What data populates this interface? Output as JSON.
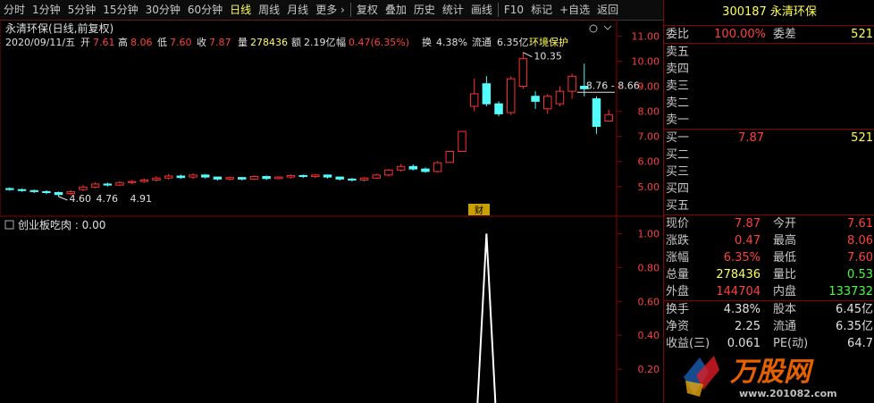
{
  "toolbar": {
    "items": [
      "分时",
      "1分钟",
      "5分钟",
      "15分钟",
      "30分钟",
      "60分钟",
      "日线",
      "周线",
      "月线",
      "更多 ›",
      "复权",
      "叠加",
      "历史",
      "统计",
      "画线",
      "F10",
      "标记",
      "+自选",
      "返回"
    ],
    "active_index": 6
  },
  "main": {
    "title": "永清环保(日线,前复权)",
    "info": {
      "date": "2020/09/11/五",
      "open_label": "开",
      "open": "7.61",
      "high_label": "高",
      "high": "8.06",
      "low_label": "低",
      "low": "7.60",
      "close_label": "收",
      "close": "7.87",
      "volume_label": "量",
      "volume": "278436",
      "amount_label": "额",
      "amount": "2.19亿",
      "change_label": "幅",
      "change": "0.47(6.35%)",
      "turnover_label": "换",
      "turnover": "4.38%",
      "float_label": "流通",
      "float": "6.35亿",
      "concept": "环境保护"
    },
    "y_ticks": [
      "11.00",
      "10.00",
      "9.00",
      "8.00",
      "7.00",
      "6.00",
      "5.00"
    ],
    "annotations": {
      "high_marker": "10.35",
      "low_marker": "4.60",
      "low_marker_b": "4.76",
      "low_marker_c": "4.91",
      "range_label": "8.76 - 8.66"
    },
    "finance_tag": "财"
  },
  "indicator": {
    "title": "创业板吃肉 : 0.00",
    "y_ticks": [
      "1.00",
      "0.80",
      "0.60",
      "0.40",
      "0.20"
    ]
  },
  "chart_data": {
    "type": "candlestick",
    "ylim": [
      4.6,
      11.3
    ],
    "candles": [
      {
        "o": 4.92,
        "c": 4.88,
        "h": 4.97,
        "l": 4.83
      },
      {
        "o": 4.88,
        "c": 4.84,
        "h": 4.92,
        "l": 4.79
      },
      {
        "o": 4.84,
        "c": 4.8,
        "h": 4.88,
        "l": 4.74
      },
      {
        "o": 4.8,
        "c": 4.76,
        "h": 4.85,
        "l": 4.7
      },
      {
        "o": 4.76,
        "c": 4.68,
        "h": 4.8,
        "l": 4.6
      },
      {
        "o": 4.72,
        "c": 4.8,
        "h": 4.86,
        "l": 4.66
      },
      {
        "o": 4.88,
        "c": 4.98,
        "h": 5.06,
        "l": 4.82
      },
      {
        "o": 4.98,
        "c": 5.1,
        "h": 5.18,
        "l": 4.93
      },
      {
        "o": 5.1,
        "c": 5.06,
        "h": 5.16,
        "l": 5.0
      },
      {
        "o": 5.06,
        "c": 5.16,
        "h": 5.22,
        "l": 5.02
      },
      {
        "o": 5.16,
        "c": 5.2,
        "h": 5.26,
        "l": 5.1
      },
      {
        "o": 5.2,
        "c": 5.26,
        "h": 5.32,
        "l": 5.14
      },
      {
        "o": 5.26,
        "c": 5.34,
        "h": 5.42,
        "l": 5.2
      },
      {
        "o": 5.34,
        "c": 5.42,
        "h": 5.5,
        "l": 5.28
      },
      {
        "o": 5.42,
        "c": 5.36,
        "h": 5.48,
        "l": 5.3
      },
      {
        "o": 5.38,
        "c": 5.46,
        "h": 5.52,
        "l": 5.3
      },
      {
        "o": 5.46,
        "c": 5.38,
        "h": 5.5,
        "l": 5.32
      },
      {
        "o": 5.38,
        "c": 5.3,
        "h": 5.4,
        "l": 5.24
      },
      {
        "o": 5.3,
        "c": 5.36,
        "h": 5.4,
        "l": 5.24
      },
      {
        "o": 5.36,
        "c": 5.3,
        "h": 5.38,
        "l": 5.24
      },
      {
        "o": 5.3,
        "c": 5.4,
        "h": 5.44,
        "l": 5.26
      },
      {
        "o": 5.4,
        "c": 5.32,
        "h": 5.44,
        "l": 5.26
      },
      {
        "o": 5.32,
        "c": 5.38,
        "h": 5.42,
        "l": 5.28
      },
      {
        "o": 5.38,
        "c": 5.44,
        "h": 5.48,
        "l": 5.32
      },
      {
        "o": 5.44,
        "c": 5.4,
        "h": 5.48,
        "l": 5.34
      },
      {
        "o": 5.4,
        "c": 5.46,
        "h": 5.5,
        "l": 5.34
      },
      {
        "o": 5.46,
        "c": 5.38,
        "h": 5.48,
        "l": 5.32
      },
      {
        "o": 5.38,
        "c": 5.3,
        "h": 5.4,
        "l": 5.24
      },
      {
        "o": 5.3,
        "c": 5.26,
        "h": 5.34,
        "l": 5.2
      },
      {
        "o": 5.26,
        "c": 5.34,
        "h": 5.38,
        "l": 5.2
      },
      {
        "o": 5.34,
        "c": 5.46,
        "h": 5.5,
        "l": 5.3
      },
      {
        "o": 5.46,
        "c": 5.66,
        "h": 5.7,
        "l": 5.4
      },
      {
        "o": 5.66,
        "c": 5.8,
        "h": 5.9,
        "l": 5.6
      },
      {
        "o": 5.8,
        "c": 5.7,
        "h": 5.88,
        "l": 5.64
      },
      {
        "o": 5.7,
        "c": 5.6,
        "h": 5.76,
        "l": 5.55
      },
      {
        "o": 5.6,
        "c": 5.95,
        "h": 6.02,
        "l": 5.56
      },
      {
        "o": 5.96,
        "c": 6.4,
        "h": 6.4,
        "l": 5.96
      },
      {
        "o": 6.4,
        "c": 7.2,
        "h": 7.2,
        "l": 6.4
      },
      {
        "o": 8.2,
        "c": 8.7,
        "h": 9.3,
        "l": 8.0
      },
      {
        "o": 9.1,
        "c": 8.3,
        "h": 9.4,
        "l": 8.2
      },
      {
        "o": 8.3,
        "c": 7.9,
        "h": 8.4,
        "l": 7.8
      },
      {
        "o": 7.95,
        "c": 9.3,
        "h": 9.4,
        "l": 7.85
      },
      {
        "o": 9.0,
        "c": 10.1,
        "h": 10.35,
        "l": 8.9
      },
      {
        "o": 8.6,
        "c": 8.4,
        "h": 8.8,
        "l": 8.1
      },
      {
        "o": 8.1,
        "c": 8.6,
        "h": 8.7,
        "l": 7.9
      },
      {
        "o": 8.3,
        "c": 8.8,
        "h": 9.0,
        "l": 8.2
      },
      {
        "o": 8.8,
        "c": 9.4,
        "h": 9.5,
        "l": 8.5
      },
      {
        "o": 9.0,
        "c": 8.9,
        "h": 9.9,
        "l": 8.6
      },
      {
        "o": 8.5,
        "c": 7.4,
        "h": 8.6,
        "l": 7.1
      },
      {
        "o": 7.61,
        "c": 7.87,
        "h": 8.06,
        "l": 7.6
      }
    ],
    "indicator_series": {
      "name": "创业板吃肉",
      "peak_index": 39,
      "peak_value": 1.0
    },
    "ylim_indicator": [
      0,
      1.05
    ]
  },
  "quote": {
    "code": "300187",
    "name": "永清环保",
    "weibi_label": "委比",
    "weibi": "100.00%",
    "weicha_label": "委差",
    "weicha": "521",
    "sell": [
      {
        "label": "卖五",
        "price": "",
        "qty": ""
      },
      {
        "label": "卖四",
        "price": "",
        "qty": ""
      },
      {
        "label": "卖三",
        "price": "",
        "qty": ""
      },
      {
        "label": "卖二",
        "price": "",
        "qty": ""
      },
      {
        "label": "卖一",
        "price": "",
        "qty": ""
      }
    ],
    "buy": [
      {
        "label": "买一",
        "price": "7.87",
        "qty": "521"
      },
      {
        "label": "买二",
        "price": "",
        "qty": ""
      },
      {
        "label": "买三",
        "price": "",
        "qty": ""
      },
      {
        "label": "买四",
        "price": "",
        "qty": ""
      },
      {
        "label": "买五",
        "price": "",
        "qty": ""
      }
    ],
    "stats": [
      {
        "l1": "现价",
        "v1": "7.87",
        "c1": "red",
        "l2": "今开",
        "v2": "7.61",
        "c2": "red"
      },
      {
        "l1": "涨跌",
        "v1": "0.47",
        "c1": "red",
        "l2": "最高",
        "v2": "8.06",
        "c2": "red"
      },
      {
        "l1": "涨幅",
        "v1": "6.35%",
        "c1": "red",
        "l2": "最低",
        "v2": "7.60",
        "c2": "red"
      },
      {
        "l1": "总量",
        "v1": "278436",
        "c1": "yellow",
        "l2": "量比",
        "v2": "0.53",
        "c2": "green"
      },
      {
        "l1": "外盘",
        "v1": "144704",
        "c1": "red",
        "l2": "内盘",
        "v2": "133732",
        "c2": "green"
      }
    ],
    "stats2": [
      {
        "l1": "换手",
        "v1": "4.38%",
        "l2": "股本",
        "v2": "6.45亿"
      },
      {
        "l1": "净资",
        "v1": "2.25",
        "l2": "流通",
        "v2": "6.35亿"
      },
      {
        "l1": "收益(三)",
        "v1": "0.061",
        "l2": "PE(动)",
        "v2": "64.7"
      }
    ]
  },
  "watermark": {
    "brand": "万股网",
    "url": "www.201082.com"
  }
}
